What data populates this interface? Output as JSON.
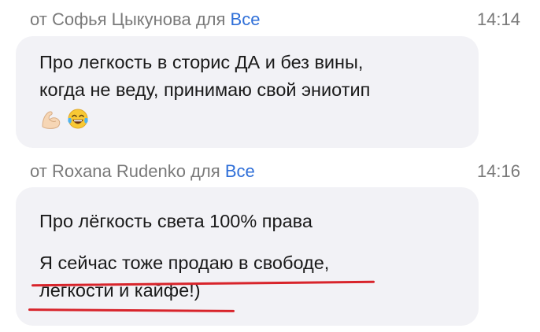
{
  "messages": [
    {
      "prefix": "от",
      "sender": "Софья Цыкунова",
      "for_word": "для",
      "recipient": "Все",
      "time": "14:14",
      "lines": [
        "Про легкость в сторис ДА и без вины,",
        "когда не веду, принимаю свой эниотип"
      ],
      "emojis": [
        "flexed-biceps-emoji",
        "tears-of-joy-emoji"
      ]
    },
    {
      "prefix": "от",
      "sender": "Roxana Rudenko",
      "for_word": "для",
      "recipient": "Все",
      "time": "14:16",
      "lines": [
        "Про лёгкость света 100% права",
        "",
        "Я сейчас тоже продаю в свободе,",
        "легкости и кайфе!)"
      ]
    }
  ],
  "colors": {
    "bubble": "#f2f2f6",
    "meta_text": "#7a7a7a",
    "recipient_link": "#2f6fd8",
    "underline": "#d8242b"
  }
}
